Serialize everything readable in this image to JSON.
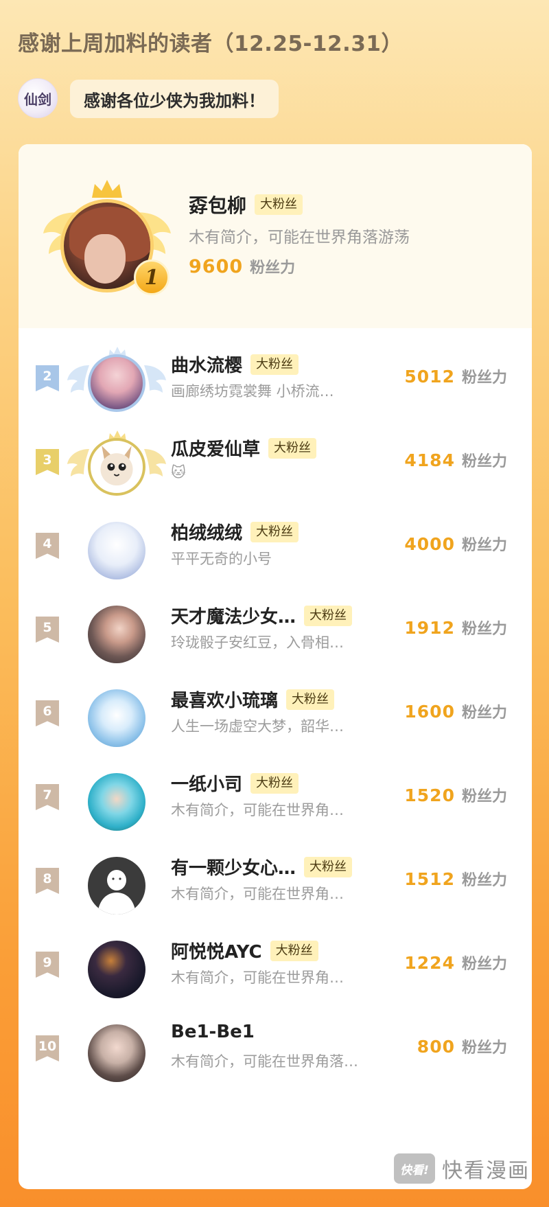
{
  "header": {
    "title": "感谢上周加料的读者（12.25-12.31）"
  },
  "greeting": {
    "logo_text": "仙剑",
    "message": "感谢各位少侠为我加料！"
  },
  "top_reader": {
    "rank": "1",
    "name": "孬包柳",
    "tag": "大粉丝",
    "bio": "木有简介，可能在世界角落游荡",
    "score": "9600",
    "unit": "粉丝力"
  },
  "rows": [
    {
      "rank": "2",
      "name": "曲水流樱",
      "tag": "大粉丝",
      "bio": "画廊绣坊霓裳舞 小桥流…",
      "score": "5012",
      "unit": "粉丝力"
    },
    {
      "rank": "3",
      "name": "瓜皮爱仙草",
      "tag": "大粉丝",
      "bio": "🐱",
      "score": "4184",
      "unit": "粉丝力"
    },
    {
      "rank": "4",
      "name": "柏绒绒绒",
      "tag": "大粉丝",
      "bio": "平平无奇的小号",
      "score": "4000",
      "unit": "粉丝力"
    },
    {
      "rank": "5",
      "name": "天才魔法少女…",
      "tag": "大粉丝",
      "bio": "玲珑骰子安红豆，入骨相…",
      "score": "1912",
      "unit": "粉丝力"
    },
    {
      "rank": "6",
      "name": "最喜欢小琉璃",
      "tag": "大粉丝",
      "bio": "人生一场虚空大梦，韶华…",
      "score": "1600",
      "unit": "粉丝力"
    },
    {
      "rank": "7",
      "name": "一纸小司",
      "tag": "大粉丝",
      "bio": "木有简介，可能在世界角…",
      "score": "1520",
      "unit": "粉丝力"
    },
    {
      "rank": "8",
      "name": "有一颗少女心…",
      "tag": "大粉丝",
      "bio": "木有简介，可能在世界角…",
      "score": "1512",
      "unit": "粉丝力"
    },
    {
      "rank": "9",
      "name": "阿悦悦AYC",
      "tag": "大粉丝",
      "bio": "木有简介，可能在世界角…",
      "score": "1224",
      "unit": "粉丝力"
    },
    {
      "rank": "10",
      "name": "Be1-Be1",
      "tag": "",
      "bio": "木有简介，可能在世界角落…",
      "score": "800",
      "unit": "粉丝力"
    }
  ],
  "watermark": {
    "logo_text": "快看!",
    "text": "快看漫画"
  },
  "colors": {
    "score": "#f0a41e",
    "tag_bg": "#fff1ba",
    "rank_silver": "#a8c6e8",
    "rank_bronze": "#e8cf69",
    "rank_plain": "#ceb9a6"
  }
}
